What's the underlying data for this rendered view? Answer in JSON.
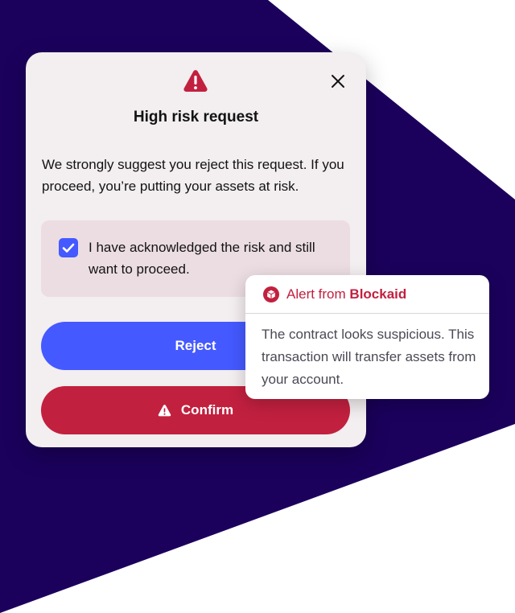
{
  "colors": {
    "background_shape": "#1b005c",
    "modal_bg": "#f3eef0",
    "ack_bg": "#ecdde2",
    "primary_blue": "#4459ff",
    "danger_red": "#c2203f",
    "text_dark": "#121314",
    "text_muted": "#4a4a55"
  },
  "modal": {
    "icon": "warning-triangle-icon",
    "close_icon": "close-icon",
    "title": "High risk request",
    "description": "We strongly suggest you reject this request. If you proceed, you’re putting your assets at risk.",
    "acknowledgement": {
      "checked": true,
      "label": "I have acknowledged the risk and still want to proceed."
    },
    "buttons": {
      "reject_label": "Reject",
      "confirm_label": "Confirm",
      "confirm_icon": "warning-triangle-icon"
    }
  },
  "alert": {
    "icon": "blockaid-cube-icon",
    "title_prefix": "Alert from",
    "title_brand": "Blockaid",
    "body": "The contract looks suspicious. This transaction will transfer assets from your account."
  }
}
